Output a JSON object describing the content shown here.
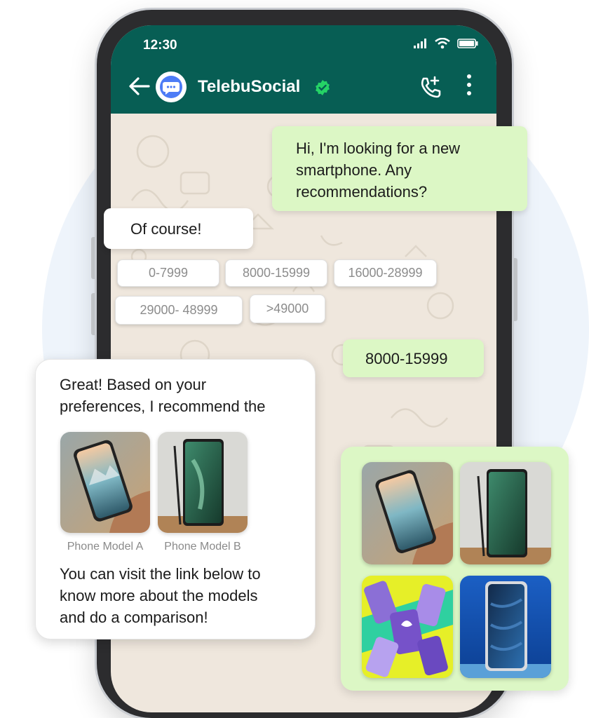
{
  "status_bar": {
    "time": "12:30"
  },
  "header": {
    "contact_name": "TelebuSocial"
  },
  "messages": {
    "outgoing_1": [
      "Hi, I'm looking for a new",
      "smartphone. Any",
      "recommendations?"
    ],
    "incoming_1": "Of course!",
    "quick_replies": [
      "0-7999",
      "8000-15999",
      "16000-28999",
      "29000- 48999",
      ">49000"
    ],
    "outgoing_2": "8000-15999"
  },
  "recommendation_card": {
    "intro_lines": [
      "Great! Based on your",
      "preferences, I recommend the"
    ],
    "products": [
      {
        "caption": "Phone Model A"
      },
      {
        "caption": "Phone Model B"
      }
    ],
    "outro_lines": [
      "You can visit the link below to",
      "know more about the models",
      "and do a comparison!"
    ]
  },
  "colors": {
    "header": "#075e54",
    "outgoing_bubble": "#dcf7c5",
    "chat_background": "#efe7dd",
    "verified_badge": "#25d366"
  },
  "icons": [
    "back-arrow-icon",
    "chat-bubble-icon",
    "verified-badge-icon",
    "add-call-icon",
    "more-vert-icon",
    "signal-icon",
    "wifi-icon",
    "battery-icon"
  ]
}
